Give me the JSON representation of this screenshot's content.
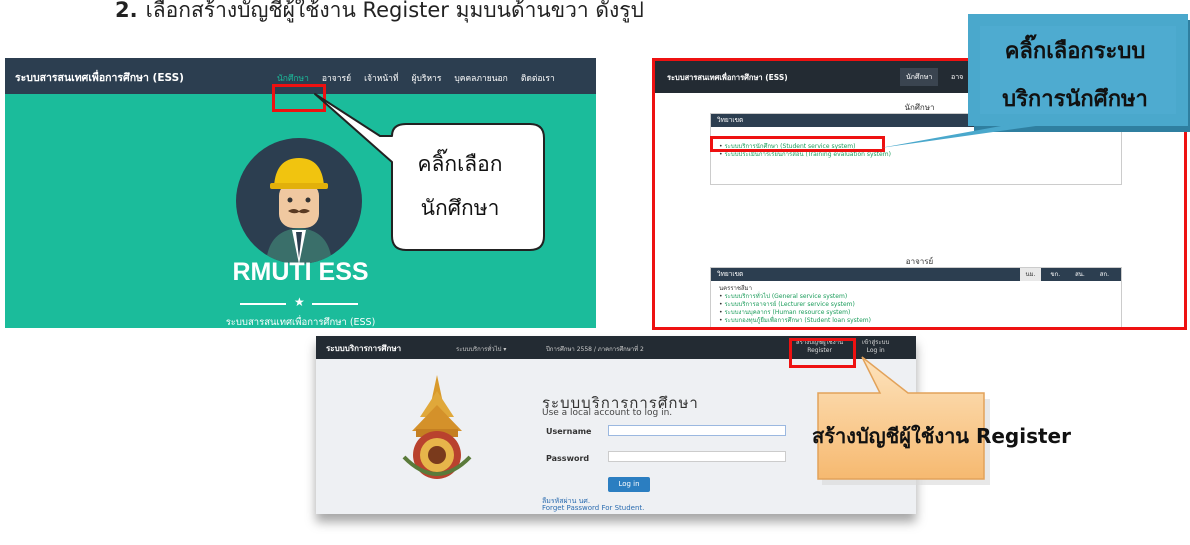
{
  "heading": {
    "number": "2.",
    "text": "เลือกสร้างบัญชีผู้ใช้งาน Register  มุมบนด้านขวา ดังรูป"
  },
  "panel1": {
    "brand": "ระบบสารสนเทศเพื่อการศึกษา (ESS)",
    "menu": [
      "นักศึกษา",
      "อาจารย์",
      "เจ้าหน้าที่",
      "ผู้บริหาร",
      "บุคคลภายนอก",
      "ติดต่อเรา"
    ],
    "title": "RMUTI ESS",
    "subtitle": "ระบบสารสนเทศเพื่อการศึกษา (ESS)",
    "callout": [
      "คลิ๊กเลือก",
      "นักศึกษา"
    ]
  },
  "panel2": {
    "brand": "ระบบสารสนเทศเพื่อการศึกษา (ESS)",
    "tabs": [
      "นักศึกษา",
      "อาจ"
    ],
    "section_student": "นักศึกษา",
    "card1": {
      "head": "วิทยาเขต",
      "items": [
        "ระบบบริการนักศึกษา (Student service system)",
        "ระบบประเมินการเรียนการสอน (Training evaluation system)"
      ]
    },
    "section_lecturer": "อาจารย์",
    "card2": {
      "head": "วิทยาเขต",
      "tabs": [
        "นม.",
        "ขก.",
        "สน.",
        "สก."
      ],
      "group": "นครราชสีมา",
      "items": [
        "ระบบบริการทั่วไป (General service system)",
        "ระบบบริการอาจารย์ (Lecturer service system)",
        "ระบบงานบุคลากร (Human resource system)",
        "ระบบกองทุนกู้ยืมเพื่อการศึกษา (Student loan system)"
      ]
    },
    "callout": [
      "คลิ๊กเลือกระบบ",
      "บริการนักศึกษา"
    ]
  },
  "panel3": {
    "brand": "ระบบบริการการศึกษา",
    "nav_general": "ระบบบริการทั่วไป ▾",
    "nav_term": "ปีการศึกษา 2558 / ภาคการศึกษาที่ 2",
    "register_th": "สร้างบัญชีผู้ใช้งาน",
    "register_en": "Register",
    "login_th": "เข้าสู่ระบบ",
    "login_en": "Log in",
    "title": "ระบบบริการการศึกษา",
    "subtitle": "Use a local account to log in.",
    "username_label": "Username",
    "password_label": "Password",
    "login_button": "Log in",
    "forgot_th": "ลืมรหัสผ่าน นศ.",
    "forgot_en": "Forget Password For Student.",
    "callout": "สร้างบัญชีผู้ใช้งาน Register"
  },
  "colors": {
    "accent_green": "#1bbc9b",
    "navy": "#2c3e50",
    "highlight_red": "#ee1111",
    "callout_blue": "#4aa8cc",
    "callout_orange": "#f9c98a"
  }
}
